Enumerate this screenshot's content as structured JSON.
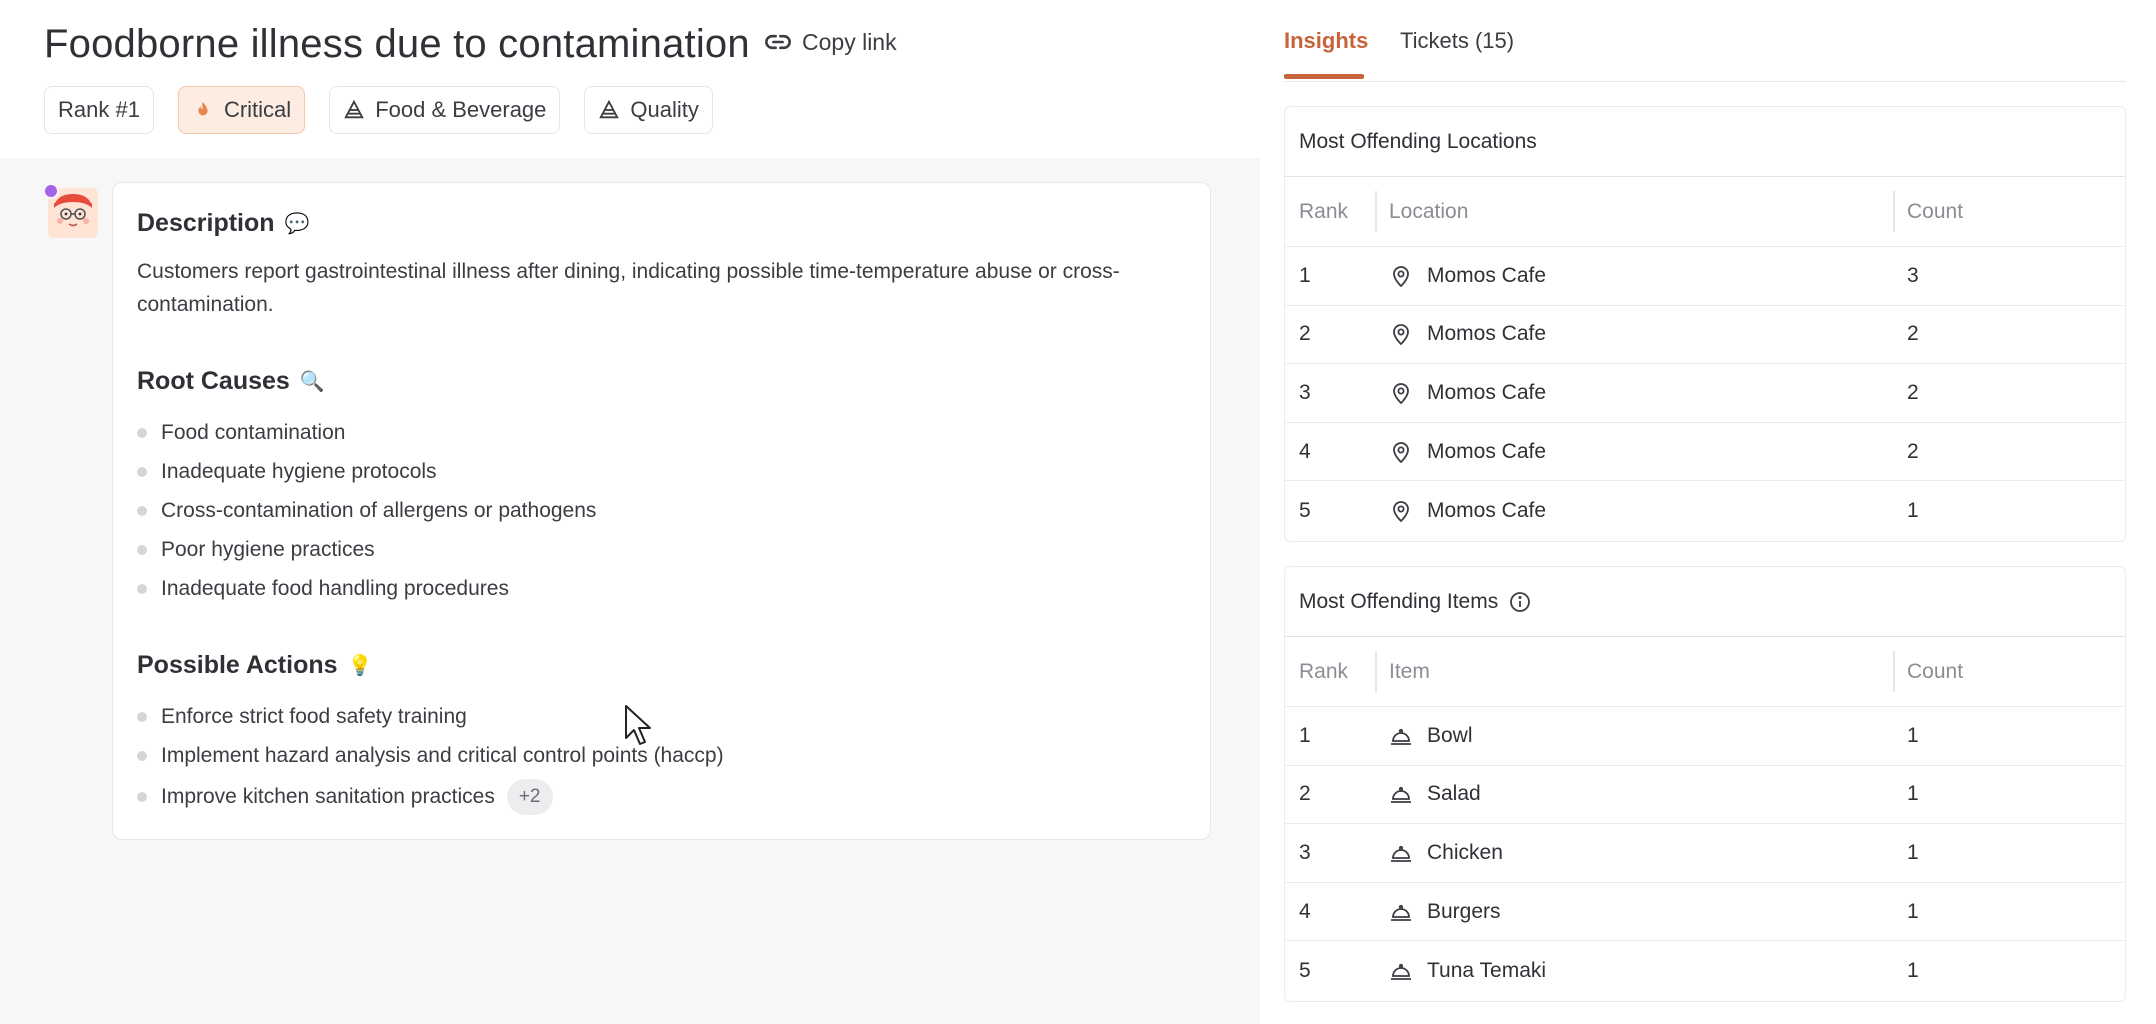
{
  "issue": {
    "title": "Foodborne illness due to contamination",
    "copy_link_label": "Copy link",
    "tags": {
      "rank": "Rank #1",
      "severity": "Critical",
      "category": "Food & Beverage",
      "type": "Quality"
    },
    "description": {
      "heading": "Description",
      "text": "Customers report gastrointestinal illness after dining, indicating possible time-temperature abuse or cross-contamination."
    },
    "root_causes": {
      "heading": "Root Causes",
      "items": [
        "Food contamination",
        "Inadequate hygiene protocols",
        "Cross-contamination of allergens or pathogens",
        "Poor hygiene practices",
        "Inadequate food handling procedures"
      ]
    },
    "possible_actions": {
      "heading": "Possible Actions",
      "items": [
        "Enforce strict food safety training",
        "Implement hazard analysis and critical control points (haccp)",
        "Improve kitchen sanitation practices"
      ],
      "more_badge": "+2"
    }
  },
  "tabs": {
    "insights": "Insights",
    "tickets": "Tickets (15)",
    "active": "insights"
  },
  "locations_table": {
    "title": "Most Offending Locations",
    "headers": {
      "rank": "Rank",
      "name": "Location",
      "count": "Count"
    },
    "rows": [
      {
        "rank": "1",
        "name": "Momos Cafe",
        "count": "3"
      },
      {
        "rank": "2",
        "name": "Momos Cafe",
        "count": "2"
      },
      {
        "rank": "3",
        "name": "Momos Cafe",
        "count": "2"
      },
      {
        "rank": "4",
        "name": "Momos Cafe",
        "count": "2"
      },
      {
        "rank": "5",
        "name": "Momos Cafe",
        "count": "1"
      }
    ]
  },
  "items_table": {
    "title": "Most Offending Items",
    "headers": {
      "rank": "Rank",
      "name": "Item",
      "count": "Count"
    },
    "rows": [
      {
        "rank": "1",
        "name": "Bowl",
        "count": "1"
      },
      {
        "rank": "2",
        "name": "Salad",
        "count": "1"
      },
      {
        "rank": "3",
        "name": "Chicken",
        "count": "1"
      },
      {
        "rank": "4",
        "name": "Burgers",
        "count": "1"
      },
      {
        "rank": "5",
        "name": "Tuna Temaki",
        "count": "1"
      }
    ]
  },
  "icons": {
    "copy_link": "link-icon",
    "severity": "flame-icon",
    "category": "pyramid-icon",
    "type": "pyramid-icon",
    "description_emoji": "💬",
    "root_causes_emoji": "🔍",
    "possible_actions_emoji": "💡",
    "location": "map-pin-icon",
    "item": "cloche-icon",
    "info": "info-icon"
  },
  "colors": {
    "accent": "#c8643b",
    "critical_bg": "#fdece2",
    "body_bg": "#f7f7f8"
  }
}
